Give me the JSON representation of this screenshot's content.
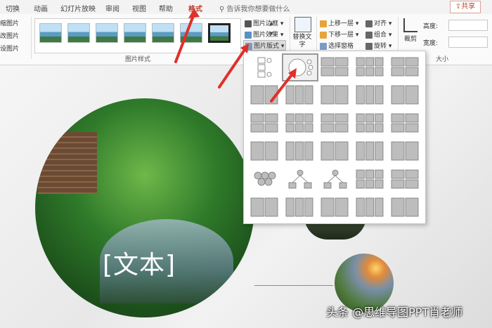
{
  "tabs": [
    {
      "label": "切换"
    },
    {
      "label": "动画"
    },
    {
      "label": "幻灯片放映"
    },
    {
      "label": "审阅"
    },
    {
      "label": "视图"
    },
    {
      "label": "帮助"
    },
    {
      "label": "格式"
    }
  ],
  "tell_me": "告诉我你想要做什么",
  "share_label": "共享",
  "ribbon": {
    "left_items": [
      "缩图片",
      "改图片",
      "设图片"
    ],
    "picture_styles_label": "图片样式",
    "picture_border": "图片边框",
    "picture_effects": "图片效果",
    "picture_layout": "图片版式",
    "alt_text": "替换文字",
    "bring_forward": "上移一层",
    "send_backward": "下移一层",
    "selection_pane": "选择窗格",
    "align": "对齐",
    "group": "组合",
    "rotate": "旋转",
    "crop": "裁剪",
    "height_label": "高度:",
    "width_label": "宽度:",
    "size_label": "大小"
  },
  "slide": {
    "placeholder_text": "[文本]",
    "watermark": "头条 @思维导图PPT肖老师"
  },
  "colors": {
    "accent_red": "#e0302a",
    "active_tab": "#c0392b"
  }
}
